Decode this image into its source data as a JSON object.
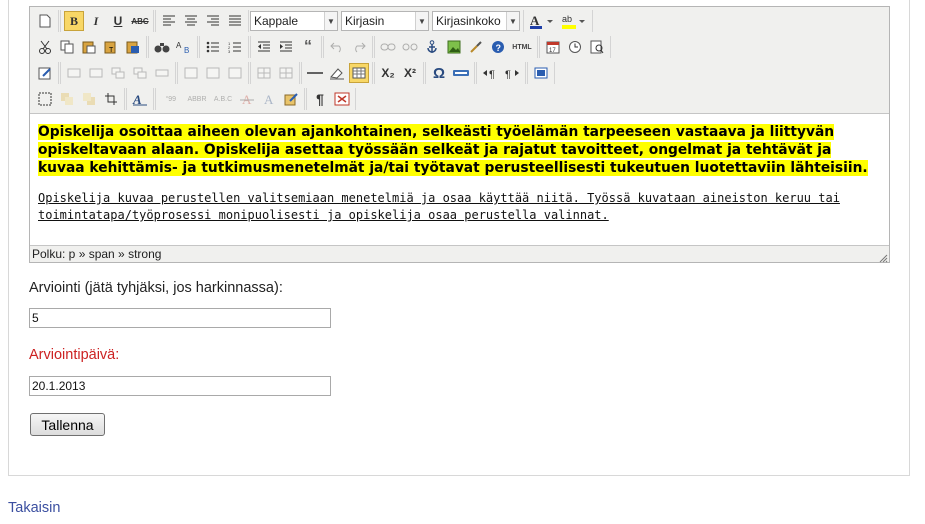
{
  "toolbar": {
    "format_select": "Kappale",
    "font_select": "Kirjasin",
    "size_select": "Kirjasinkoko",
    "bold": "B",
    "italic": "I",
    "underline": "U",
    "strike": "ABC",
    "subscript": "X₂",
    "superscript": "X²",
    "omega": "Ω",
    "pilcrow": "¶"
  },
  "editor": {
    "highlighted_paragraph": "Opiskelija osoittaa aiheen olevan ajankohtainen, selkeästi työelämän tarpeeseen vastaava ja liittyvän opiskeltavaan alaan. Opiskelija asettaa työssään selkeät ja rajatut tavoitteet, ongelmat ja tehtävät ja kuvaa kehittämis- ja tutkimusmenetelmät ja/tai työtavat perusteellisesti tukeutuen luotettaviin lähteisiin.",
    "mono_paragraph": "Opiskelija kuvaa perustellen valitsemiaan menetelmiä ja osaa käyttää niitä. Työssä kuvataan aineiston keruu tai toimintatapa/työprosessi monipuolisesti ja opiskelija osaa perustella valinnat.",
    "status_path": "Polku: p » span » strong"
  },
  "form": {
    "grade_label": "Arviointi (jätä tyhjäksi, jos harkinnassa):",
    "grade_value": "5",
    "date_label": "Arviointipäivä:",
    "date_value": "20.1.2013",
    "save_label": "Tallenna",
    "date_label_color": "#cc2222"
  },
  "back_link": "Takaisin"
}
